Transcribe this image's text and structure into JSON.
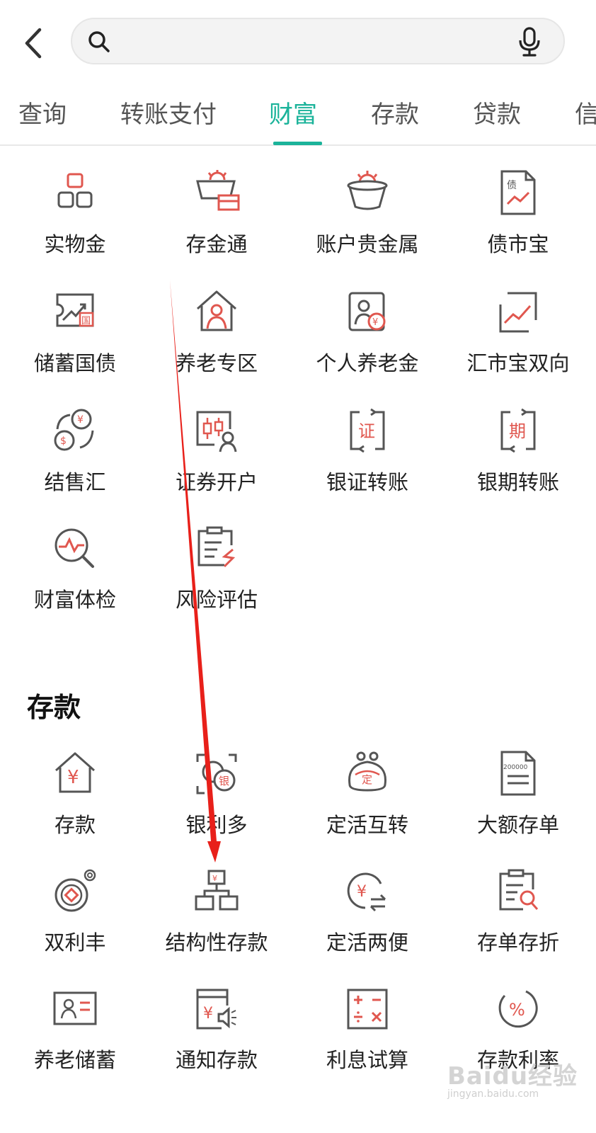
{
  "search": {
    "placeholder": "",
    "value": ""
  },
  "tabs": [
    {
      "label": "查询"
    },
    {
      "label": "转账支付"
    },
    {
      "label": "财富",
      "active": true
    },
    {
      "label": "存款"
    },
    {
      "label": "贷款"
    },
    {
      "label": "信"
    }
  ],
  "wealth": {
    "items": [
      {
        "label": "实物金",
        "icon": "gold-bars-icon"
      },
      {
        "label": "存金通",
        "icon": "gold-basket-card-icon"
      },
      {
        "label": "账户贵金属",
        "icon": "gold-basket-icon"
      },
      {
        "label": "债市宝",
        "icon": "bond-document-icon"
      },
      {
        "label": "储蓄国债",
        "icon": "treasury-bond-icon"
      },
      {
        "label": "养老专区",
        "icon": "elderly-house-icon"
      },
      {
        "label": "个人养老金",
        "icon": "pension-icon"
      },
      {
        "label": "汇市宝双向",
        "icon": "forex-trend-icon"
      },
      {
        "label": "结售汇",
        "icon": "currency-exchange-icon"
      },
      {
        "label": "证券开户",
        "icon": "securities-account-icon"
      },
      {
        "label": "银证转账",
        "icon": "bank-securities-transfer-icon"
      },
      {
        "label": "银期转账",
        "icon": "bank-futures-transfer-icon"
      },
      {
        "label": "财富体检",
        "icon": "wealth-checkup-icon"
      },
      {
        "label": "风险评估",
        "icon": "risk-assessment-icon"
      }
    ]
  },
  "deposit": {
    "title": "存款",
    "items": [
      {
        "label": "存款",
        "icon": "deposit-house-icon"
      },
      {
        "label": "银利多",
        "icon": "yinliduo-icon",
        "icon_text": "银"
      },
      {
        "label": "定活互转",
        "icon": "fixed-current-purse-icon",
        "icon_text": "定"
      },
      {
        "label": "大额存单",
        "icon": "large-certificate-icon",
        "icon_text": "200000"
      },
      {
        "label": "双利丰",
        "icon": "coin-target-icon"
      },
      {
        "label": "结构性存款",
        "icon": "structured-deposit-icon"
      },
      {
        "label": "定活两便",
        "icon": "fixed-current-exchange-icon"
      },
      {
        "label": "存单存折",
        "icon": "passbook-search-icon"
      },
      {
        "label": "养老储蓄",
        "icon": "pension-savings-card-icon"
      },
      {
        "label": "通知存款",
        "icon": "notice-deposit-icon"
      },
      {
        "label": "利息试算",
        "icon": "calculator-icon"
      },
      {
        "label": "存款利率",
        "icon": "interest-rate-icon"
      }
    ]
  },
  "watermark": {
    "line1": "Baidu经验",
    "line2": "jingyan.baidu.com"
  },
  "colors": {
    "accent": "#1bb39a",
    "icon_red": "#e0574f",
    "icon_gray": "#555555",
    "arrow": "#e8201a"
  }
}
